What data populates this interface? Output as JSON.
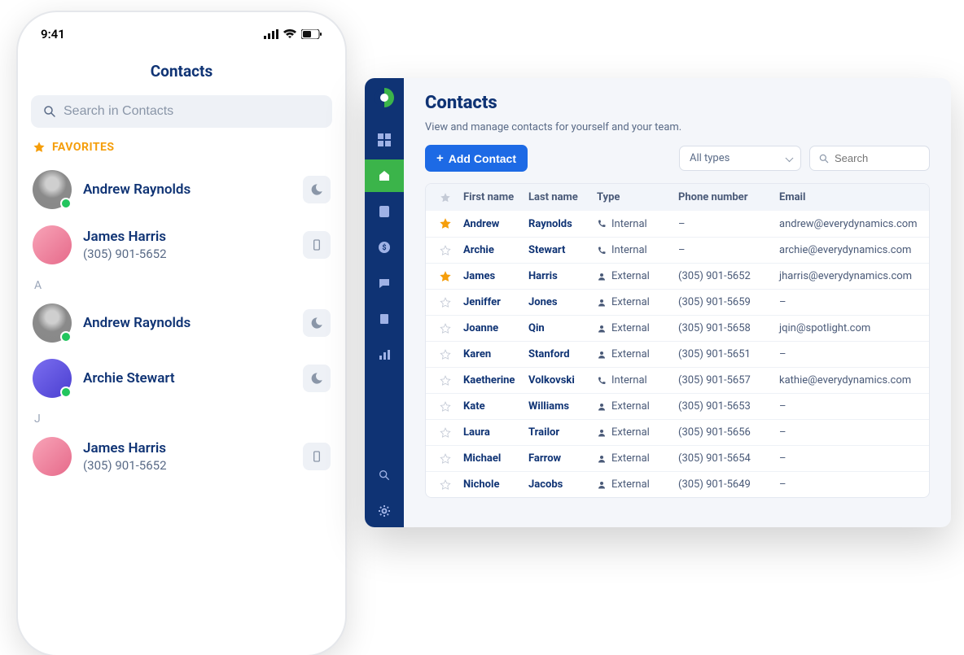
{
  "mobile": {
    "time": "9:41",
    "title": "Contacts",
    "search_placeholder": "Search in Contacts",
    "favorites_label": "FAVORITES",
    "favorites": [
      {
        "name": "Andrew Raynolds",
        "phone": "",
        "avatar": "grey",
        "icon": "moon",
        "dot": true
      },
      {
        "name": "James Harris",
        "phone": "(305) 901-5652",
        "avatar": "pink",
        "icon": "phone",
        "dot": false
      }
    ],
    "sections": [
      {
        "letter": "A",
        "items": [
          {
            "name": "Andrew Raynolds",
            "phone": "",
            "avatar": "grey",
            "icon": "moon",
            "dot": true
          },
          {
            "name": "Archie Stewart",
            "phone": "",
            "avatar": "blue",
            "icon": "moon",
            "dot": true
          }
        ]
      },
      {
        "letter": "J",
        "items": [
          {
            "name": "James Harris",
            "phone": "(305) 901-5652",
            "avatar": "pink",
            "icon": "phone",
            "dot": false
          }
        ]
      }
    ]
  },
  "desktop": {
    "title": "Contacts",
    "subtitle": "View and manage contacts for yourself and your team.",
    "add_label": "Add Contact",
    "filter_label": "All types",
    "search_placeholder": "Search",
    "headers": {
      "first": "First name",
      "last": "Last name",
      "type": "Type",
      "phone": "Phone number",
      "email": "Email"
    },
    "rows": [
      {
        "star": true,
        "first": "Andrew",
        "last": "Raynolds",
        "type": "Internal",
        "phone": "–",
        "email": "andrew@everydynamics.com"
      },
      {
        "star": false,
        "first": "Archie",
        "last": "Stewart",
        "type": "Internal",
        "phone": "–",
        "email": "archie@everydynamics.com"
      },
      {
        "star": true,
        "first": "James",
        "last": "Harris",
        "type": "External",
        "phone": "(305) 901-5652",
        "email": "jharris@everydynamics.com"
      },
      {
        "star": false,
        "first": "Jeniffer",
        "last": "Jones",
        "type": "External",
        "phone": "(305) 901-5659",
        "email": "–"
      },
      {
        "star": false,
        "first": "Joanne",
        "last": "Qin",
        "type": "External",
        "phone": "(305) 901-5658",
        "email": "jqin@spotlight.com"
      },
      {
        "star": false,
        "first": "Karen",
        "last": "Stanford",
        "type": "External",
        "phone": "(305) 901-5651",
        "email": "–"
      },
      {
        "star": false,
        "first": "Kaetherine",
        "last": "Volkovski",
        "type": "Internal",
        "phone": "(305) 901-5657",
        "email": "kathie@everydynamics.com"
      },
      {
        "star": false,
        "first": "Kate",
        "last": "Williams",
        "type": "External",
        "phone": "(305) 901-5653",
        "email": "–"
      },
      {
        "star": false,
        "first": "Laura",
        "last": "Trailor",
        "type": "External",
        "phone": "(305) 901-5656",
        "email": "–"
      },
      {
        "star": false,
        "first": "Michael",
        "last": "Farrow",
        "type": "External",
        "phone": "(305) 901-5654",
        "email": "–"
      },
      {
        "star": false,
        "first": "Nichole",
        "last": "Jacobs",
        "type": "External",
        "phone": "(305) 901-5649",
        "email": "–"
      }
    ]
  }
}
